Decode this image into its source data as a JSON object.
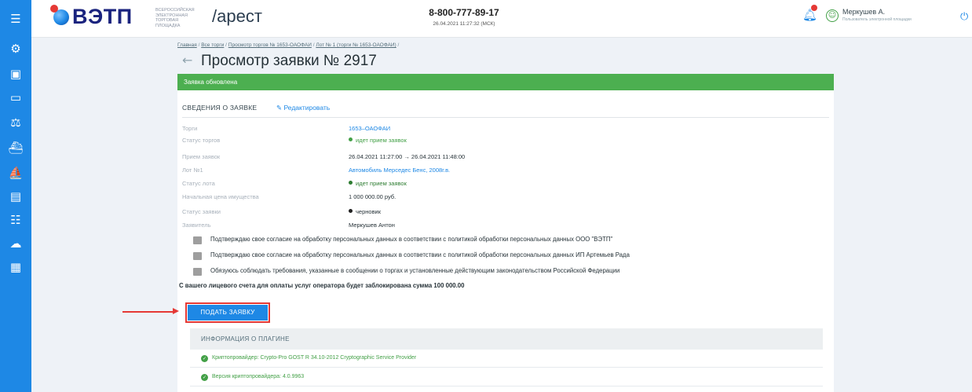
{
  "sidebar": {
    "icons": [
      "menu-icon",
      "settings-gear-icon",
      "document-icon",
      "card-icon",
      "scale-icon",
      "ship-icon",
      "ship-outline-icon",
      "clipboard-icon",
      "list-icon",
      "cloud-icon",
      "contract-icon"
    ]
  },
  "header": {
    "logo_text": "ВЭТП",
    "logo_subtitle": [
      "ВСЕРОССИЙСКАЯ",
      "ЭЛЕКТРОННАЯ",
      "ТОРГОВАЯ ПЛОЩАДКА"
    ],
    "app_name": "/арест",
    "phone": "8-800-777-89-17",
    "datetime": "26.04.2021 11:27:32 (МСК)",
    "user_name": "Меркушев А.",
    "user_role": "Пользователь электронной площадки"
  },
  "breadcrumb": {
    "items": [
      "Главная",
      "Все торги",
      "Просмотр торгов № 1653-ОАОФАИ",
      "Лот № 1 (торги № 1653-ОАОФАИ)"
    ],
    "separator": "/"
  },
  "page": {
    "title": "Просмотр заявки № 2917"
  },
  "banner": {
    "text": "Заявка обновлена"
  },
  "details": {
    "section_title": "СВЕДЕНИЯ О ЗАЯВКЕ",
    "edit_label": "Редактировать",
    "rows": [
      {
        "label": "Торги",
        "value": "1653–ОАОФАИ"
      },
      {
        "label": "Статус торгов",
        "value": "идет прием заявок"
      },
      {
        "label": "Прием заявок",
        "value": "26.04.2021 11:27:00 → 26.04.2021 11:48:00"
      },
      {
        "label": "Лот №1",
        "value": "Автомобиль Мерседес Бенс, 2008г.в."
      },
      {
        "label": "Статус лота",
        "value": "идет прием заявок"
      },
      {
        "label": "Начальная цена имущества",
        "value": "1 000 000.00 руб."
      },
      {
        "label": "Статус заявки",
        "value": "черновик"
      },
      {
        "label": "Заявитель",
        "value": "Меркушев Антон"
      }
    ]
  },
  "consents": [
    "Подтверждаю свое согласие на обработку персональных данных в соответствии с политикой обработки персональных данных ООО \"ВЭТП\"",
    "Подтверждаю свое согласие на обработку персональных данных в соответствии с политикой обработки персональных данных ИП Артемьев Рада",
    "Обязуюсь соблюдать требования, указанные в сообщении о торгах и установленные действующим законодательством Российской Федерации"
  ],
  "block_note": "С вашего лицевого счета для оплаты услуг оператора будет заблокирована сумма 100 000.00",
  "submit_label": "ПОДАТЬ ЗАЯВКУ",
  "plugin": {
    "title": "ИНФОРМАЦИЯ О ПЛАГИНЕ",
    "rows": [
      "Криптопровайдер: Crypto-Pro GOST R 34.10-2012 Cryptographic Service Provider",
      "Версия криптопровайдера: 4.0.9963"
    ]
  },
  "colors": {
    "sidebar": "#1e88e5",
    "banner_green": "#4caf50",
    "accent_blue": "#1e88e5",
    "highlight_red": "#e53935",
    "status_green": "#43a047"
  }
}
